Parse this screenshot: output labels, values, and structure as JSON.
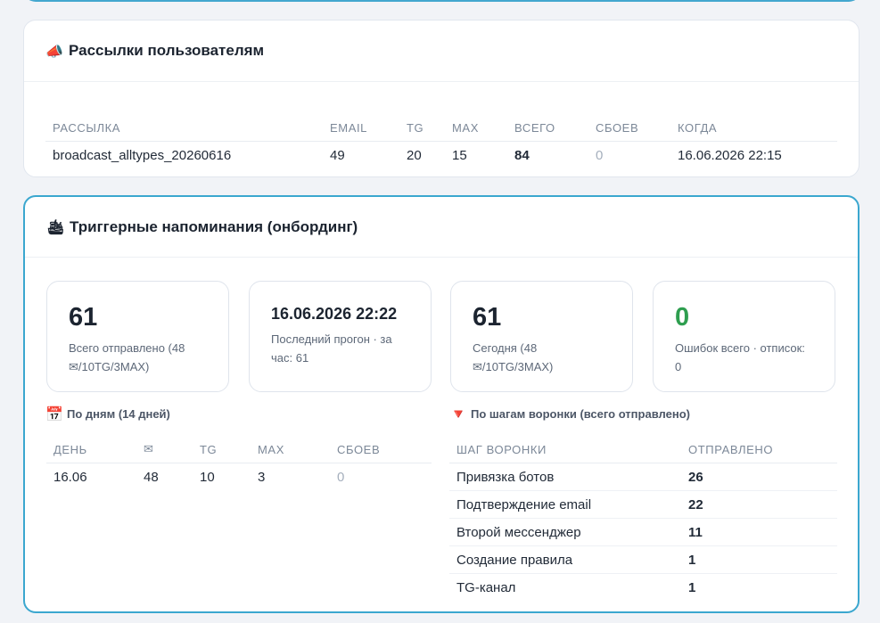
{
  "broadcast": {
    "icon": "megaphone-icon",
    "title": "Рассылки пользователям",
    "columns": [
      "РАССЫЛКА",
      "EMAIL",
      "TG",
      "MAX",
      "ВСЕГО",
      "СБОЕВ",
      "КОГДА"
    ],
    "rows": [
      {
        "name": "broadcast_alltypes_20260616",
        "email": "49",
        "tg": "20",
        "max": "15",
        "total": "84",
        "failures": "0",
        "when": "16.06.2026 22:15"
      }
    ]
  },
  "trigger": {
    "icon": "ship-icon",
    "title": "Триггерные напоминания (онбординг)",
    "stats": [
      {
        "value": "61",
        "label": "Всего отправлено (48 ✉/10TG/3MAX)"
      },
      {
        "value": "16.06.2026 22:22",
        "label": "Последний прогон · за час: 61"
      },
      {
        "value": "61",
        "label": "Сегодня (48 ✉/10TG/3MAX)"
      },
      {
        "value": "0",
        "label": "Ошибок всего · отписок: 0"
      }
    ],
    "daily": {
      "icon": "calendar-icon",
      "title": "По дням (14 дней)",
      "columns": [
        "ДЕНЬ",
        "✉",
        "TG",
        "MAX",
        "СБОЕВ"
      ],
      "rows": [
        {
          "day": "16.06",
          "email": "48",
          "tg": "10",
          "max": "3",
          "failures": "0"
        }
      ]
    },
    "funnel": {
      "icon": "funnel-icon",
      "title": "По шагам воронки (всего отправлено)",
      "columns": [
        "ШАГ ВОРОНКИ",
        "ОТПРАВЛЕНО"
      ],
      "rows": [
        {
          "step": "Привязка ботов",
          "sent": "26"
        },
        {
          "step": "Подтверждение email",
          "sent": "22"
        },
        {
          "step": "Второй мессенджер",
          "sent": "11"
        },
        {
          "step": "Создание правила",
          "sent": "1"
        },
        {
          "step": "TG-канал",
          "sent": "1"
        }
      ]
    }
  },
  "colors": {
    "accent": "#3ba7cf",
    "success": "#2e9e4f",
    "muted": "#a5afbd"
  }
}
